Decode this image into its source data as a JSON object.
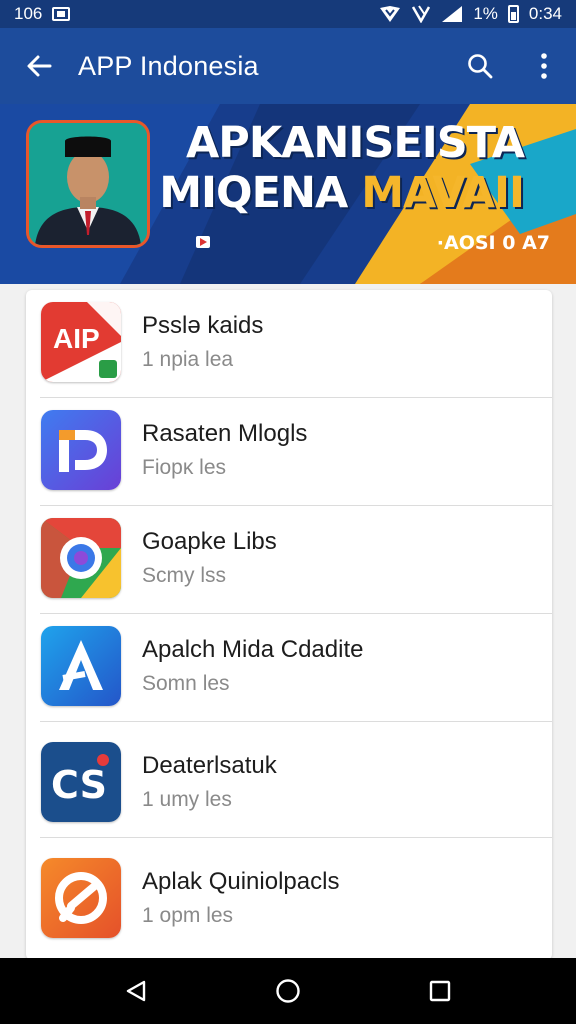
{
  "status_bar": {
    "time_left": "106",
    "battery": "1%",
    "clock": "0:34"
  },
  "app_bar": {
    "title": "APP Indonesia"
  },
  "banner": {
    "line1": "APKANISEISTA",
    "line2_main": "MIQENA ",
    "line2_accent": "MAVAII",
    "code": "·AOSI 0 A7"
  },
  "apps": [
    {
      "name": "Psslə kaids",
      "sub": "1 npia lea",
      "icon": "aip-icon"
    },
    {
      "name": "Rasaten Mlogls",
      "sub": "Fiopκ les",
      "icon": "pd-icon"
    },
    {
      "name": "Goapke Libs",
      "sub": "Scmy lss",
      "icon": "chrome-like-icon"
    },
    {
      "name": "Apalch Mida Cdadite",
      "sub": "Somn les",
      "icon": "a-logo-icon"
    },
    {
      "name": "Deaterlsatuk",
      "sub": "1 umy les",
      "icon": "cs-icon"
    },
    {
      "name": "Aplak Quiniolpacls",
      "sub": "1 opm les",
      "icon": "orange-c-icon"
    }
  ],
  "colors": {
    "app_bar": "#1d4c9c",
    "status_bar": "#163a7a",
    "banner_accent": "#f5b62b"
  }
}
